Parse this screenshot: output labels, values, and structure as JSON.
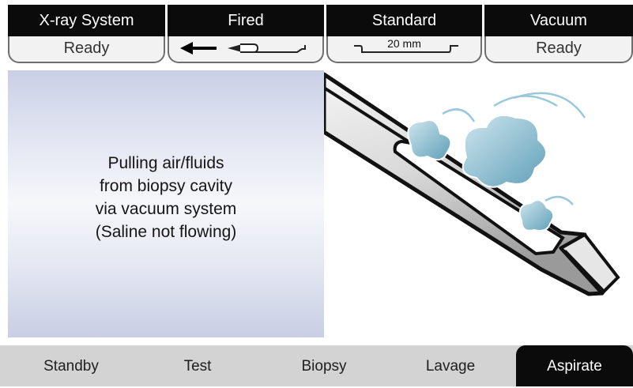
{
  "status_panels": [
    {
      "title": "X-ray System",
      "status": "Ready"
    },
    {
      "title": "Fired",
      "status": "",
      "icon": "arrow-left-needle-icon"
    },
    {
      "title": "Standard",
      "status": "20 mm",
      "icon": "aperture-size-icon"
    },
    {
      "title": "Vacuum",
      "status": "Ready"
    }
  ],
  "info": {
    "lines": [
      "Pulling air/fluids",
      "from biopsy cavity",
      "via vacuum system",
      "(Saline not flowing)"
    ]
  },
  "illustration": {
    "icon": "biopsy-needle-aspiration-icon"
  },
  "modes": [
    {
      "label": "Standby",
      "active": false
    },
    {
      "label": "Test",
      "active": false
    },
    {
      "label": "Biopsy",
      "active": false
    },
    {
      "label": "Lavage",
      "active": false
    },
    {
      "label": "Aspirate",
      "active": true
    }
  ],
  "colors": {
    "header_bg": "#0b0b0b",
    "active_mode_bg": "#0b0b0b",
    "mode_bar_bg": "#d3d3d3",
    "info_bg": "#e6e9f3",
    "swirl": "#7fb3c9"
  }
}
